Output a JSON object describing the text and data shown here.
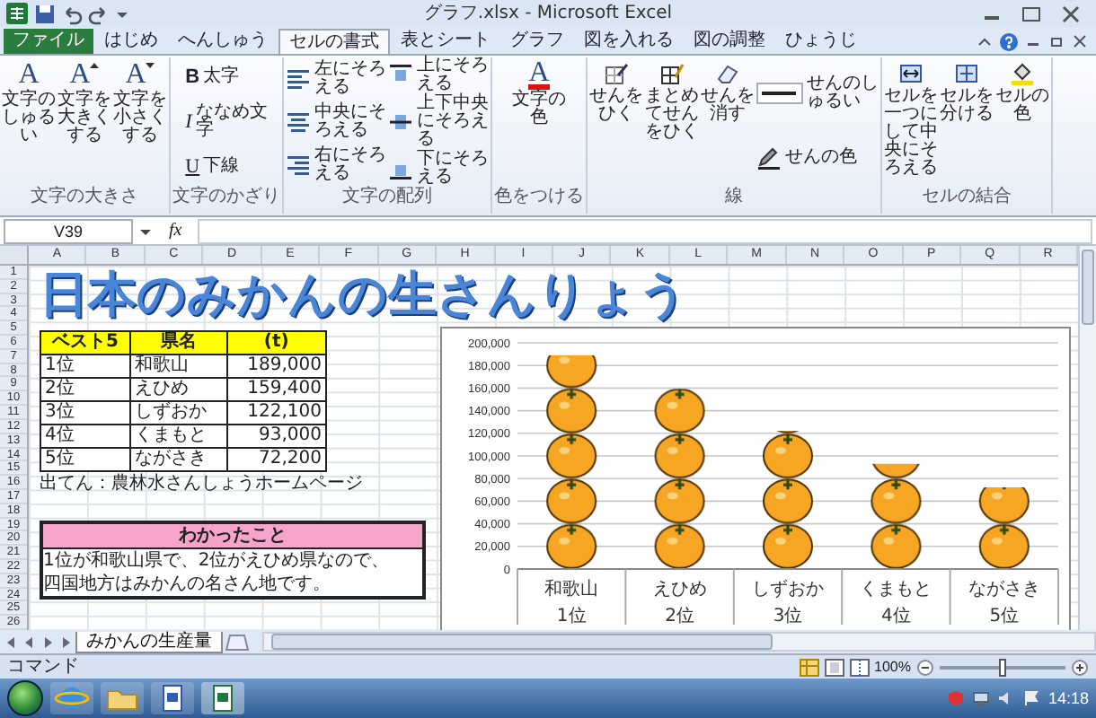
{
  "window": {
    "title": "グラフ.xlsx - Microsoft Excel"
  },
  "tabs": [
    {
      "label": "ファイル",
      "kind": "file",
      "selected": false
    },
    {
      "label": "はじめ",
      "kind": "tab",
      "selected": false
    },
    {
      "label": "へんしゅう",
      "kind": "tab",
      "selected": false
    },
    {
      "label": "セルの書式",
      "kind": "tab",
      "selected": true
    },
    {
      "label": "表とシート",
      "kind": "tab",
      "selected": false
    },
    {
      "label": "グラフ",
      "kind": "tab",
      "selected": false
    },
    {
      "label": "図を入れる",
      "kind": "tab",
      "selected": false
    },
    {
      "label": "図の調整",
      "kind": "tab",
      "selected": false
    },
    {
      "label": "ひょうじ",
      "kind": "tab",
      "selected": false
    }
  ],
  "ribbon_groups": [
    {
      "label": "文字の大きさ",
      "columns": [
        [
          {
            "kind": "glyph",
            "glyph": "A",
            "label": "文字のしゅるい"
          }
        ],
        [
          {
            "kind": "grow",
            "glyph": "A",
            "label": "文字を大きくする"
          }
        ],
        [
          {
            "kind": "shrink",
            "glyph": "A",
            "label": "文字を小さくする"
          }
        ]
      ]
    },
    {
      "label": "文字のかざり",
      "columns": [
        [
          {
            "kind": "bold",
            "glyph": "B",
            "label": "太字"
          },
          {
            "kind": "italic",
            "glyph": "I",
            "label": "ななめ文字"
          },
          {
            "kind": "underline",
            "glyph": "U",
            "label": "下線"
          }
        ]
      ]
    },
    {
      "label": "文字の配列",
      "columns": [
        [
          {
            "kind": "align-left",
            "label": "左にそろえる"
          },
          {
            "kind": "align-center",
            "label": "中央にそろえる"
          },
          {
            "kind": "align-right",
            "label": "右にそろえる"
          }
        ],
        [
          {
            "kind": "align-top",
            "label": "上にそろえる"
          },
          {
            "kind": "align-middle",
            "label": "上下中央にそろえる"
          },
          {
            "kind": "align-bottom",
            "label": "下にそろえる"
          }
        ]
      ]
    },
    {
      "label": "色をつける",
      "columns": [
        [
          {
            "kind": "font-color",
            "glyph": "A",
            "label": "文字の色"
          }
        ]
      ]
    },
    {
      "label": "線",
      "columns": [
        [
          {
            "kind": "border",
            "label": "せんをひく"
          }
        ],
        [
          {
            "kind": "border-all",
            "label": "まとめてせんをひく"
          }
        ],
        [
          {
            "kind": "eraser",
            "label": "せんを消す"
          }
        ],
        [
          {
            "kind": "line-style",
            "label": "せんのしゅるい"
          },
          {
            "kind": "line-color",
            "label": "せんの色"
          }
        ]
      ]
    },
    {
      "label": "セルの結合",
      "columns": [
        [
          {
            "kind": "merge",
            "label": "セルを一つにして中央にそろえる"
          }
        ],
        [
          {
            "kind": "split",
            "label": "セルを分ける"
          }
        ],
        [
          {
            "kind": "fill",
            "label": "セルの色"
          }
        ]
      ]
    }
  ],
  "formula_bar": {
    "name_box": "V39",
    "function_label": "fx"
  },
  "grid": {
    "columns": [
      "A",
      "B",
      "C",
      "D",
      "E",
      "F",
      "G",
      "H",
      "I",
      "J",
      "K",
      "L",
      "M",
      "N",
      "O",
      "P",
      "Q",
      "R"
    ],
    "rows": [
      "1",
      "2",
      "3",
      "4",
      "5",
      "6",
      "7",
      "8",
      "9",
      "10",
      "11",
      "12",
      "13",
      "14",
      "15",
      "16",
      "17",
      "18",
      "19",
      "20",
      "21",
      "22",
      "23",
      "24",
      "25",
      "26"
    ]
  },
  "sheet": {
    "title": "日本のみかんの生さんりょう",
    "table": {
      "columns": [
        "ベスト5",
        "県名",
        "(t)"
      ],
      "rows": [
        [
          "1位",
          "和歌山",
          "189,000"
        ],
        [
          "2位",
          "えひめ",
          "159,400"
        ],
        [
          "3位",
          "しずおか",
          "122,100"
        ],
        [
          "4位",
          "くまもと",
          "93,000"
        ],
        [
          "5位",
          "ながさき",
          "72,200"
        ]
      ]
    },
    "source_note": "出てん：農林水さんしょうホームページ",
    "chart": {
      "ranks": [
        "1位",
        "2位",
        "3位",
        "4位",
        "5位"
      ],
      "chart_data": {
        "type": "bar",
        "categories": [
          "和歌山",
          "えひめ",
          "しずおか",
          "くまもと",
          "ながさき"
        ],
        "values": [
          189000,
          159400,
          122100,
          93000,
          72200
        ],
        "ylim": [
          0,
          200000
        ],
        "grid": true,
        "yticks": [
          {
            "value": 0,
            "label": "0"
          },
          {
            "value": 20000,
            "label": "20,000"
          },
          {
            "value": 40000,
            "label": "40,000"
          },
          {
            "value": 60000,
            "label": "60,000"
          },
          {
            "value": 80000,
            "label": "80,000"
          },
          {
            "value": 100000,
            "label": "100,000"
          },
          {
            "value": 120000,
            "label": "120,000"
          },
          {
            "value": 140000,
            "label": "140,000"
          },
          {
            "value": 160000,
            "label": "160,000"
          },
          {
            "value": 180000,
            "label": "180,000"
          },
          {
            "value": 200000,
            "label": "200,000"
          }
        ]
      }
    },
    "findings": {
      "heading": "わかったこと",
      "lines": [
        "1位が和歌山県で、2位がえひめ県なので、",
        "四国地方はみかんの名さん地です。"
      ]
    }
  },
  "sheet_tabs": [
    {
      "label": "みかんの生産量",
      "selected": true
    }
  ],
  "status_bar": {
    "mode": "コマンド",
    "zoom": "100%",
    "zoom_slider": {
      "level": 0.5
    }
  },
  "taskbar": {
    "clock": "14:18"
  }
}
